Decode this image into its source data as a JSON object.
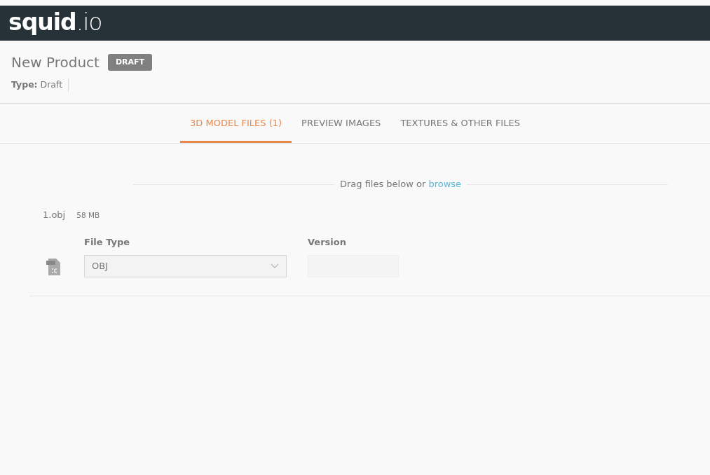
{
  "logo": "**squid**.io",
  "product": {
    "title": "New Product",
    "status_badge": "DRAFT",
    "type_label": "Type:",
    "type_value": "Draft"
  },
  "tabs": [
    {
      "label": "3D MODEL FILES (1)",
      "selected": true
    },
    {
      "label": "PREVIEW IMAGES",
      "selected": false
    },
    {
      "label": "TEXTURES & OTHER FILES",
      "selected": false
    }
  ],
  "dropzone": {
    "text": "Drag files below or",
    "link": "browse"
  },
  "files": [
    {
      "name": "1.obj",
      "size": "58 MB",
      "file_type_label": "File Type",
      "file_type_value": "OBJ",
      "version_label": "Version"
    }
  ]
}
